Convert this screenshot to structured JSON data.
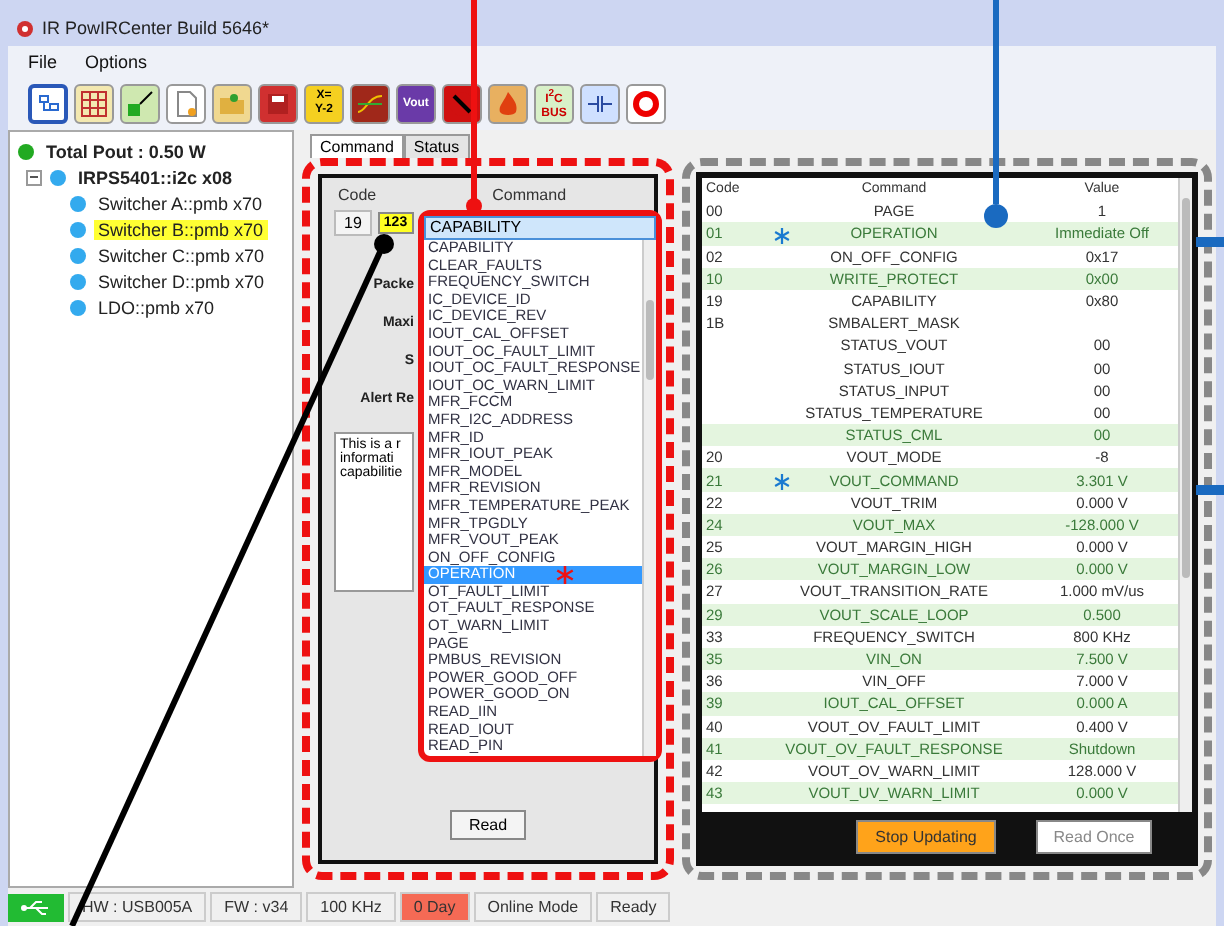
{
  "window": {
    "title": "IR PowIRCenter Build 5646*"
  },
  "menu": [
    "File",
    "Options"
  ],
  "toolbar": [
    {
      "kind": "tree"
    },
    {
      "kind": "grid"
    },
    {
      "kind": "resize"
    },
    {
      "kind": "new"
    },
    {
      "kind": "open"
    },
    {
      "kind": "save"
    },
    {
      "kind": "formula",
      "lines": [
        "X=",
        "Y-2"
      ]
    },
    {
      "kind": "waveform"
    },
    {
      "kind": "vout",
      "lines": [
        "Vout"
      ]
    },
    {
      "kind": "stop"
    },
    {
      "kind": "fire"
    },
    {
      "kind": "bus",
      "lines": [
        "I$^{2}$C",
        "BUS"
      ]
    },
    {
      "kind": "capacitor"
    },
    {
      "kind": "lifebuoy"
    }
  ],
  "tree": {
    "total": {
      "label": "Total Pout : 0.50 W",
      "color": "#22aa22"
    },
    "device": {
      "label": "IRPS5401::i2c x08",
      "color": "#33aaee",
      "expanded": true,
      "children": [
        {
          "label": "Switcher A::pmb x70",
          "color": "#33aaee",
          "selected": false
        },
        {
          "label": "Switcher B::pmb x70",
          "color": "#33aaee",
          "selected": true
        },
        {
          "label": "Switcher C::pmb x70",
          "color": "#33aaee",
          "selected": false
        },
        {
          "label": "Switcher D::pmb x70",
          "color": "#33aaee",
          "selected": false
        },
        {
          "label": "LDO::pmb x70",
          "color": "#33aaee",
          "selected": false
        }
      ]
    }
  },
  "tabs": [
    {
      "label": "Command",
      "selected": true
    },
    {
      "label": "Status",
      "selected": false
    }
  ],
  "command_panel": {
    "code_label": "Code",
    "command_label": "Command",
    "code": "19",
    "code_button": "123",
    "command_value": "CAPABILITY",
    "labels": [
      "Packe",
      "Maxi",
      "S",
      "Alert Re"
    ],
    "description": "This is a r\ninformati\ncapabilitie",
    "read_button": "Read",
    "options": [
      {
        "label": "CAPABILITY",
        "selected": false,
        "starred": false
      },
      {
        "label": "CLEAR_FAULTS",
        "selected": false,
        "starred": false
      },
      {
        "label": "FREQUENCY_SWITCH",
        "selected": false,
        "starred": false
      },
      {
        "label": "IC_DEVICE_ID",
        "selected": false,
        "starred": false
      },
      {
        "label": "IC_DEVICE_REV",
        "selected": false,
        "starred": false
      },
      {
        "label": "IOUT_CAL_OFFSET",
        "selected": false,
        "starred": false
      },
      {
        "label": "IOUT_OC_FAULT_LIMIT",
        "selected": false,
        "starred": false
      },
      {
        "label": "IOUT_OC_FAULT_RESPONSE",
        "selected": false,
        "starred": false
      },
      {
        "label": "IOUT_OC_WARN_LIMIT",
        "selected": false,
        "starred": false
      },
      {
        "label": "MFR_FCCM",
        "selected": false,
        "starred": false
      },
      {
        "label": "MFR_I2C_ADDRESS",
        "selected": false,
        "starred": false
      },
      {
        "label": "MFR_ID",
        "selected": false,
        "starred": false
      },
      {
        "label": "MFR_IOUT_PEAK",
        "selected": false,
        "starred": false
      },
      {
        "label": "MFR_MODEL",
        "selected": false,
        "starred": false
      },
      {
        "label": "MFR_REVISION",
        "selected": false,
        "starred": false
      },
      {
        "label": "MFR_TEMPERATURE_PEAK",
        "selected": false,
        "starred": false
      },
      {
        "label": "MFR_TPGDLY",
        "selected": false,
        "starred": false
      },
      {
        "label": "MFR_VOUT_PEAK",
        "selected": false,
        "starred": false
      },
      {
        "label": "ON_OFF_CONFIG",
        "selected": false,
        "starred": false
      },
      {
        "label": "OPERATION",
        "selected": true,
        "starred": true
      },
      {
        "label": "OT_FAULT_LIMIT",
        "selected": false,
        "starred": false
      },
      {
        "label": "OT_FAULT_RESPONSE",
        "selected": false,
        "starred": false
      },
      {
        "label": "OT_WARN_LIMIT",
        "selected": false,
        "starred": false
      },
      {
        "label": "PAGE",
        "selected": false,
        "starred": false
      },
      {
        "label": "PMBUS_REVISION",
        "selected": false,
        "starred": false
      },
      {
        "label": "POWER_GOOD_OFF",
        "selected": false,
        "starred": false
      },
      {
        "label": "POWER_GOOD_ON",
        "selected": false,
        "starred": false
      },
      {
        "label": "READ_IIN",
        "selected": false,
        "starred": false
      },
      {
        "label": "READ_IOUT",
        "selected": false,
        "starred": false
      },
      {
        "label": "READ_PIN",
        "selected": false,
        "starred": false
      }
    ]
  },
  "table": {
    "columns": [
      "Code",
      "Command",
      "Value"
    ],
    "rows": [
      {
        "code": "00",
        "command": "PAGE",
        "value": "1",
        "highlighted": false,
        "starred": false
      },
      {
        "code": "01",
        "command": "OPERATION",
        "value": "Immediate Off",
        "highlighted": true,
        "starred": true
      },
      {
        "code": "02",
        "command": "ON_OFF_CONFIG",
        "value": "0x17",
        "highlighted": false,
        "starred": false
      },
      {
        "code": "10",
        "command": "WRITE_PROTECT",
        "value": "0x00",
        "highlighted": true,
        "starred": false
      },
      {
        "code": "19",
        "command": "CAPABILITY",
        "value": "0x80",
        "highlighted": false,
        "starred": false
      },
      {
        "code": "1B",
        "command": "SMBALERT_MASK",
        "value": "",
        "highlighted": false,
        "starred": false
      },
      {
        "code": "",
        "command": "STATUS_VOUT",
        "value": "00",
        "highlighted": false,
        "starred": false
      },
      {
        "code": "",
        "command": "STATUS_IOUT",
        "value": "00",
        "highlighted": false,
        "starred": false
      },
      {
        "code": "",
        "command": "STATUS_INPUT",
        "value": "00",
        "highlighted": false,
        "starred": false
      },
      {
        "code": "",
        "command": "STATUS_TEMPERATURE",
        "value": "00",
        "highlighted": false,
        "starred": false
      },
      {
        "code": "",
        "command": "STATUS_CML",
        "value": "00",
        "highlighted": true,
        "starred": false
      },
      {
        "code": "20",
        "command": "VOUT_MODE",
        "value": "-8",
        "highlighted": false,
        "starred": false
      },
      {
        "code": "21",
        "command": "VOUT_COMMAND",
        "value": "3.301 V",
        "highlighted": true,
        "starred": true
      },
      {
        "code": "22",
        "command": "VOUT_TRIM",
        "value": "0.000 V",
        "highlighted": false,
        "starred": false
      },
      {
        "code": "24",
        "command": "VOUT_MAX",
        "value": "-128.000 V",
        "highlighted": true,
        "starred": false
      },
      {
        "code": "25",
        "command": "VOUT_MARGIN_HIGH",
        "value": "0.000 V",
        "highlighted": false,
        "starred": false
      },
      {
        "code": "26",
        "command": "VOUT_MARGIN_LOW",
        "value": "0.000 V",
        "highlighted": true,
        "starred": false
      },
      {
        "code": "27",
        "command": "VOUT_TRANSITION_RATE",
        "value": "1.000 mV/us",
        "highlighted": false,
        "starred": false
      },
      {
        "code": "29",
        "command": "VOUT_SCALE_LOOP",
        "value": "0.500",
        "highlighted": true,
        "starred": false
      },
      {
        "code": "33",
        "command": "FREQUENCY_SWITCH",
        "value": "800 KHz",
        "highlighted": false,
        "starred": false
      },
      {
        "code": "35",
        "command": "VIN_ON",
        "value": "7.500 V",
        "highlighted": true,
        "starred": false
      },
      {
        "code": "36",
        "command": "VIN_OFF",
        "value": "7.000 V",
        "highlighted": false,
        "starred": false
      },
      {
        "code": "39",
        "command": "IOUT_CAL_OFFSET",
        "value": "0.000 A",
        "highlighted": true,
        "starred": false
      },
      {
        "code": "40",
        "command": "VOUT_OV_FAULT_LIMIT",
        "value": "0.400 V",
        "highlighted": false,
        "starred": false
      },
      {
        "code": "41",
        "command": "VOUT_OV_FAULT_RESPONSE",
        "value": "Shutdown",
        "highlighted": true,
        "starred": false
      },
      {
        "code": "42",
        "command": "VOUT_OV_WARN_LIMIT",
        "value": "128.000 V",
        "highlighted": false,
        "starred": false
      },
      {
        "code": "43",
        "command": "VOUT_UV_WARN_LIMIT",
        "value": "0.000 V",
        "highlighted": true,
        "starred": false
      }
    ]
  },
  "buttons": [
    {
      "label": "Stop Updating",
      "kind": "primary"
    },
    {
      "label": "Read Once",
      "kind": "plain"
    }
  ],
  "status_bar": [
    {
      "kind": "usb"
    },
    {
      "kind": "text",
      "label": "HW : USB005A"
    },
    {
      "kind": "text",
      "label": "FW : v34"
    },
    {
      "kind": "text",
      "label": "100 KHz"
    },
    {
      "kind": "alert",
      "label": "0 Day"
    },
    {
      "kind": "text",
      "label": "Online Mode"
    },
    {
      "kind": "text",
      "label": "Ready"
    }
  ]
}
